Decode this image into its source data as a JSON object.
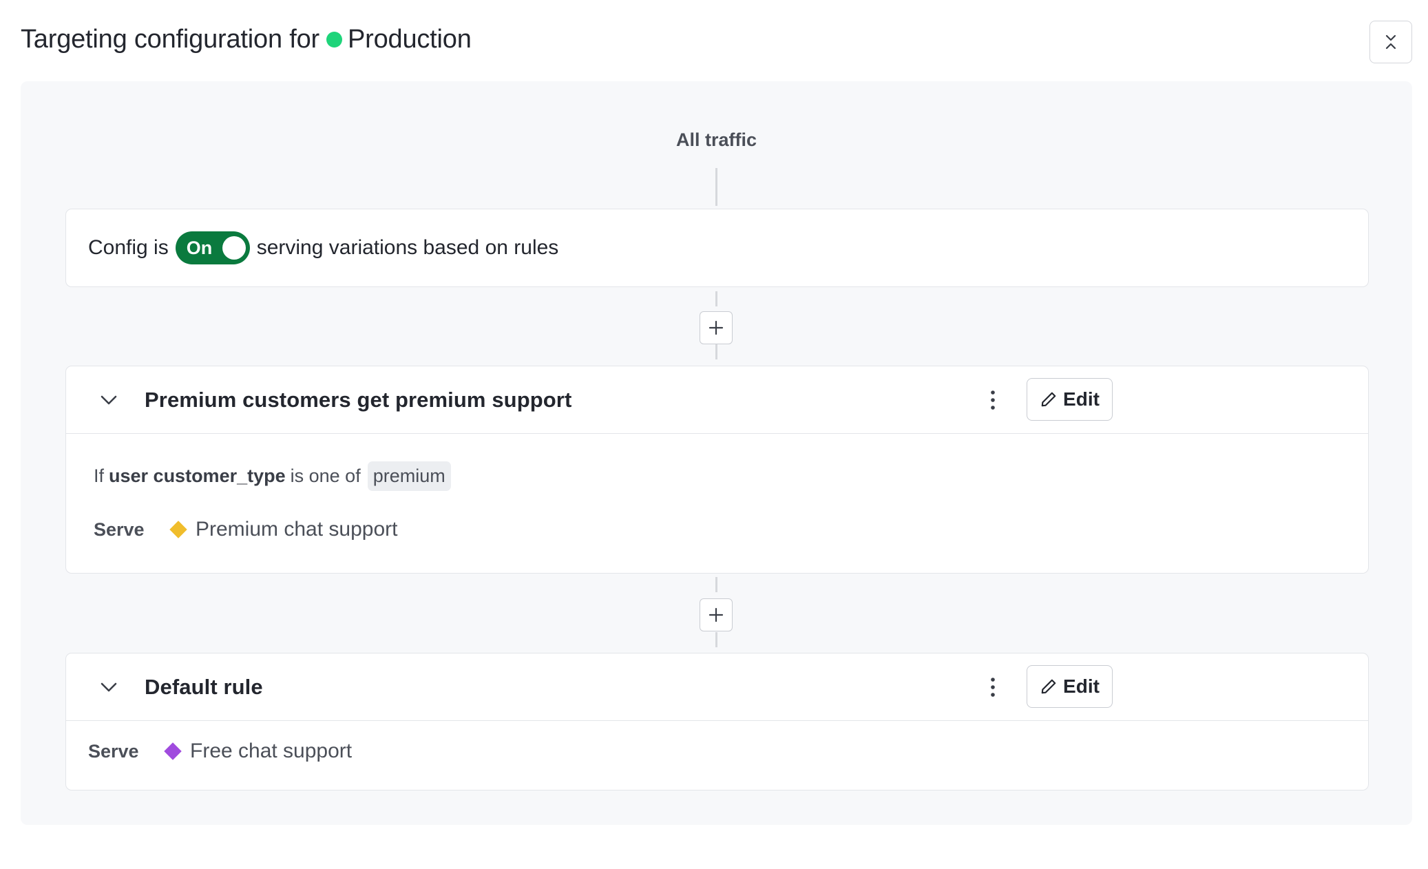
{
  "header": {
    "title_prefix": "Targeting configuration for",
    "environment": "Production",
    "environment_color": "#1ed47a",
    "collapse_icon": "collapse-icon"
  },
  "flow": {
    "start_label": "All traffic",
    "config": {
      "prefix": "Config is",
      "toggle_label": "On",
      "toggle_state": true,
      "toggle_color": "#0a7a3e",
      "suffix": "serving variations based on rules"
    },
    "rules": [
      {
        "title": "Premium customers get premium support",
        "condition": {
          "if_label": "If",
          "attribute": "user customer_type",
          "operator": "is one of",
          "values": [
            "premium"
          ]
        },
        "serve_label": "Serve",
        "variation": "Premium chat support",
        "variation_color": "#f0bd2c",
        "edit_label": "Edit"
      }
    ],
    "default_rule": {
      "title": "Default rule",
      "serve_label": "Serve",
      "variation": "Free chat support",
      "variation_color": "#a04bde",
      "edit_label": "Edit"
    }
  }
}
